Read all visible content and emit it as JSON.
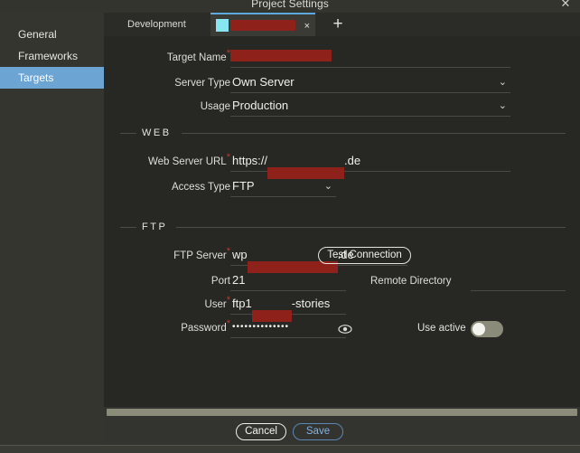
{
  "window": {
    "title": "Project Settings",
    "close_icon": "close-icon",
    "close_glyph": "✕"
  },
  "sidebar": {
    "items": [
      {
        "label": "General",
        "active": false
      },
      {
        "label": "Frameworks",
        "active": false
      },
      {
        "label": "Targets",
        "active": true
      }
    ]
  },
  "tabs": {
    "items": [
      {
        "label": "Development",
        "active": false
      },
      {
        "label": "",
        "active": true,
        "redacted": true
      }
    ],
    "close_glyph": "×",
    "add_glyph": "+"
  },
  "form": {
    "target_name": {
      "label": "Target Name",
      "required": "*",
      "value": "",
      "redacted": true
    },
    "server_type": {
      "label": "Server Type",
      "value": "Own Server",
      "caret": "⌄"
    },
    "usage": {
      "label": "Usage",
      "value": "Production",
      "caret": "⌄"
    }
  },
  "web_section": {
    "title": "WEB",
    "web_server_url": {
      "label": "Web Server URL",
      "required": "*",
      "prefix": "https://",
      "suffix": ".de",
      "redacted": true
    },
    "access_type": {
      "label": "Access Type",
      "value": "FTP",
      "caret": "⌄"
    }
  },
  "ftp_section": {
    "title": "FTP",
    "ftp_server": {
      "label": "FTP Server",
      "required": "*",
      "prefix": "wp",
      "suffix": ".de",
      "redacted": true
    },
    "test_connection_label": "Test Connection",
    "port": {
      "label": "Port",
      "value": "21"
    },
    "remote_directory": {
      "label": "Remote Directory",
      "value": ""
    },
    "user": {
      "label": "User",
      "required": "*",
      "prefix": "ftp1",
      "suffix": "-stories",
      "redacted": true
    },
    "password": {
      "label": "Password",
      "required": "*",
      "value": "••••••••••••••",
      "reveal_icon": "eye-icon"
    },
    "use_active": {
      "label": "Use active",
      "enabled": false
    }
  },
  "footer": {
    "cancel_label": "Cancel",
    "save_label": "Save"
  },
  "colors": {
    "accent_blue": "#6ca4d4",
    "save_blue": "#7fb4e2",
    "redaction_red": "#8e2119",
    "required_red": "#c0392b",
    "tab_icon_cyan": "#87e6f0",
    "scrollbar_olive": "#8b8b7a",
    "panel_bg": "#272724",
    "window_bg": "#33332f",
    "sidebar_bg": "#353530"
  }
}
